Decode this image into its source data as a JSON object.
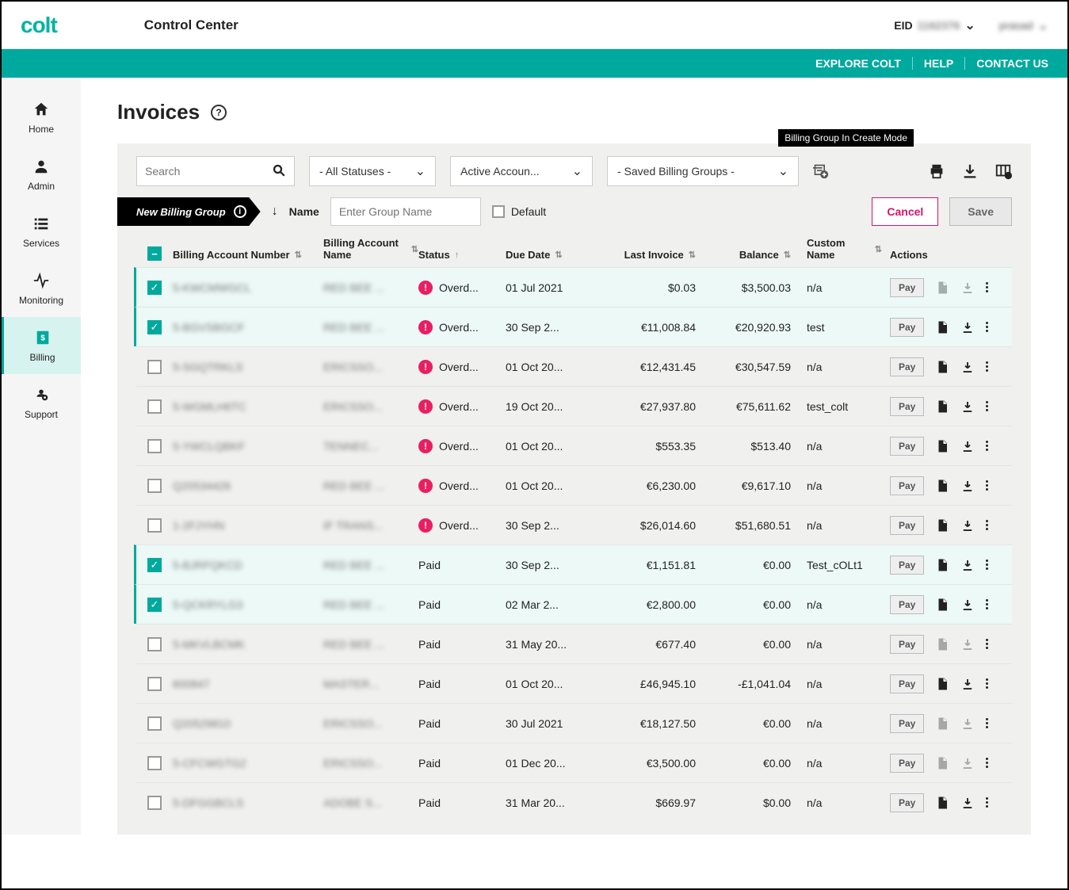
{
  "header": {
    "brand": "colt",
    "title": "Control Center",
    "eid_label": "EID",
    "eid_value": "1162376",
    "user": "prasad"
  },
  "tealnav": {
    "explore": "EXPLORE COLT",
    "help": "HELP",
    "contact": "CONTACT US"
  },
  "sidebar": {
    "items": [
      {
        "label": "Home"
      },
      {
        "label": "Admin"
      },
      {
        "label": "Services"
      },
      {
        "label": "Monitoring"
      },
      {
        "label": "Billing"
      },
      {
        "label": "Support"
      }
    ]
  },
  "page": {
    "title": "Invoices",
    "help": "?"
  },
  "filters": {
    "search_placeholder": "Search",
    "status": "- All Statuses -",
    "account": "Active Accoun...",
    "saved": "- Saved Billing Groups -",
    "tooltip": "Billing Group In Create Mode"
  },
  "newgroup": {
    "ribbon": "New Billing Group",
    "name_label": "Name",
    "name_placeholder": "Enter Group Name",
    "default_label": "Default",
    "cancel": "Cancel",
    "save": "Save"
  },
  "columns": {
    "ban": "Billing Account Number",
    "bname": "Billing Account Name",
    "status": "Status",
    "due": "Due Date",
    "last": "Last Invoice",
    "bal": "Balance",
    "custom": "Custom Name",
    "actions": "Actions"
  },
  "pay_label": "Pay",
  "rows": [
    {
      "sel": true,
      "ban": "5-KWCMWGCL",
      "bname": "RED BEE ...",
      "status": "Overd...",
      "overdue": true,
      "due": "01 Jul 2021",
      "last": "$0.03",
      "bal": "$3,500.03",
      "custom": "n/a",
      "doc": false,
      "dl": false
    },
    {
      "sel": true,
      "ban": "5-BGVSBGCF",
      "bname": "RED BEE ...",
      "status": "Overd...",
      "overdue": true,
      "due": "30 Sep 2...",
      "last": "€11,008.84",
      "bal": "€20,920.93",
      "custom": "test",
      "doc": true,
      "dl": true
    },
    {
      "sel": false,
      "ban": "5-SGQTRKLS",
      "bname": "ERICSSO...",
      "status": "Overd...",
      "overdue": true,
      "due": "01 Oct 20...",
      "last": "€12,431.45",
      "bal": "€30,547.59",
      "custom": "n/a",
      "doc": true,
      "dl": true
    },
    {
      "sel": false,
      "ban": "5-WGMLH6TC",
      "bname": "ERICSSO...",
      "status": "Overd...",
      "overdue": true,
      "due": "19 Oct 20...",
      "last": "€27,937.80",
      "bal": "€75,611.62",
      "custom": "test_colt",
      "doc": true,
      "dl": true
    },
    {
      "sel": false,
      "ban": "5-YWCLQBKF",
      "bname": "TENNEC...",
      "status": "Overd...",
      "overdue": true,
      "due": "01 Oct 20...",
      "last": "$553.35",
      "bal": "$513.40",
      "custom": "n/a",
      "doc": true,
      "dl": true
    },
    {
      "sel": false,
      "ban": "Q20534426",
      "bname": "RED BEE ...",
      "status": "Overd...",
      "overdue": true,
      "due": "01 Oct 20...",
      "last": "€6,230.00",
      "bal": "€9,617.10",
      "custom": "n/a",
      "doc": true,
      "dl": true
    },
    {
      "sel": false,
      "ban": "1-2FJYHN",
      "bname": "IF TRANS...",
      "status": "Overd...",
      "overdue": true,
      "due": "30 Sep 2...",
      "last": "$26,014.60",
      "bal": "$51,680.51",
      "custom": "n/a",
      "doc": true,
      "dl": true
    },
    {
      "sel": true,
      "ban": "5-BJRFQKCD",
      "bname": "RED BEE ...",
      "status": "Paid",
      "overdue": false,
      "due": "30 Sep 2...",
      "last": "€1,151.81",
      "bal": "€0.00",
      "custom": "Test_cOLt1",
      "doc": true,
      "dl": true
    },
    {
      "sel": true,
      "ban": "5-QCKRYLG3",
      "bname": "RED BEE ...",
      "status": "Paid",
      "overdue": false,
      "due": "02 Mar 2...",
      "last": "€2,800.00",
      "bal": "€0.00",
      "custom": "n/a",
      "doc": true,
      "dl": true
    },
    {
      "sel": false,
      "ban": "5-MKVLBCMK",
      "bname": "RED BEE ...",
      "status": "Paid",
      "overdue": false,
      "due": "31 May 20...",
      "last": "€677.40",
      "bal": "€0.00",
      "custom": "n/a",
      "doc": false,
      "dl": false
    },
    {
      "sel": false,
      "ban": "600847",
      "bname": "MASTER...",
      "status": "Paid",
      "overdue": false,
      "due": "01 Oct 20...",
      "last": "£46,945.10",
      "bal": "-£1,041.04",
      "custom": "n/a",
      "doc": true,
      "dl": true
    },
    {
      "sel": false,
      "ban": "Q20529810",
      "bname": "ERICSSO...",
      "status": "Paid",
      "overdue": false,
      "due": "30 Jul 2021",
      "last": "€18,127.50",
      "bal": "€0.00",
      "custom": "n/a",
      "doc": false,
      "dl": false
    },
    {
      "sel": false,
      "ban": "5-CFCWGTG2",
      "bname": "ERICSSO...",
      "status": "Paid",
      "overdue": false,
      "due": "01 Dec 20...",
      "last": "€3,500.00",
      "bal": "€0.00",
      "custom": "n/a",
      "doc": false,
      "dl": false
    },
    {
      "sel": false,
      "ban": "5-DFGGBCLS",
      "bname": "ADOBE S...",
      "status": "Paid",
      "overdue": false,
      "due": "31 Mar 20...",
      "last": "$669.97",
      "bal": "$0.00",
      "custom": "n/a",
      "doc": true,
      "dl": true
    }
  ]
}
